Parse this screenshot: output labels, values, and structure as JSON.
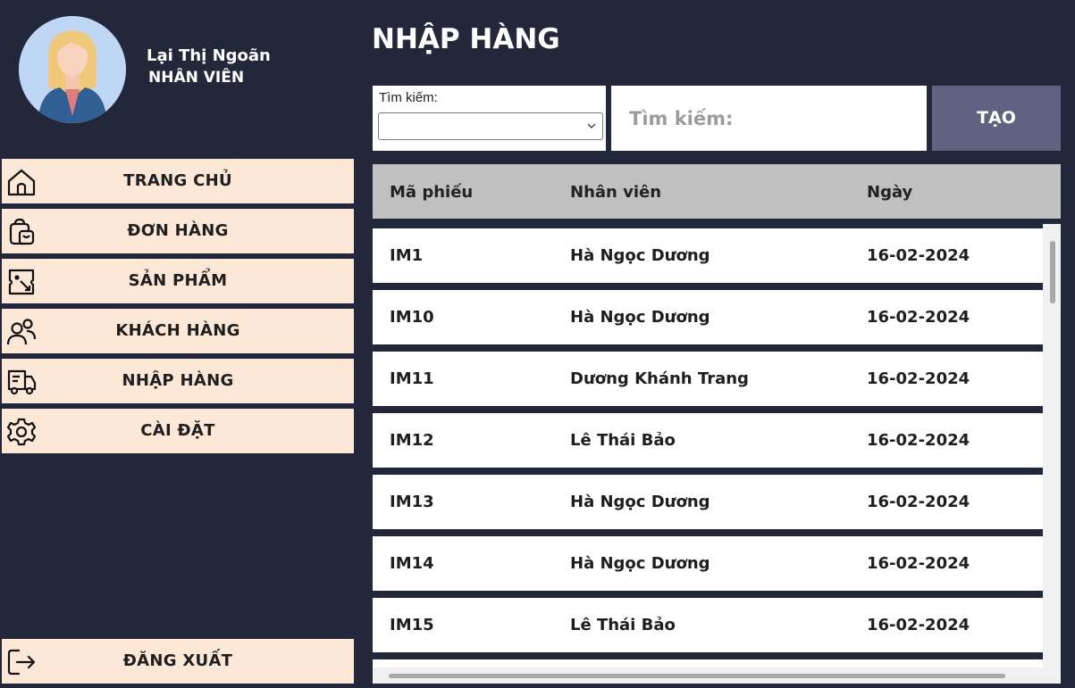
{
  "user": {
    "name": "Lại Thị Ngoãn",
    "role": "NHÂN VIÊN",
    "avatar_icon": "female-user-avatar"
  },
  "sidebar": {
    "items": [
      {
        "label": "TRANG CHỦ",
        "icon": "home-icon"
      },
      {
        "label": "ĐƠN HÀNG",
        "icon": "shopping-bag-icon"
      },
      {
        "label": "SẢN PHẨM",
        "icon": "product-tag-icon"
      },
      {
        "label": "KHÁCH HÀNG",
        "icon": "customers-icon"
      },
      {
        "label": "NHẬP HÀNG",
        "icon": "truck-icon"
      },
      {
        "label": "CÀI ĐẶT",
        "icon": "gear-icon"
      }
    ],
    "logout": {
      "label": "ĐĂNG XUẤT",
      "icon": "logout-icon"
    }
  },
  "main": {
    "title": "NHẬP HÀNG",
    "filter": {
      "label": "Tìm kiếm:",
      "selected": ""
    },
    "search": {
      "placeholder": "Tìm kiếm:",
      "value": ""
    },
    "create_label": "TẠO",
    "table": {
      "columns": [
        "Mã phiếu",
        "Nhân viên",
        "Ngày"
      ],
      "rows": [
        [
          "IM1",
          "Hà Ngọc Dương",
          "16-02-2024"
        ],
        [
          "IM10",
          "Hà Ngọc Dương",
          "16-02-2024"
        ],
        [
          "IM11",
          "Dương Khánh Trang",
          "16-02-2024"
        ],
        [
          "IM12",
          "Lê Thái Bảo",
          "16-02-2024"
        ],
        [
          "IM13",
          "Hà Ngọc Dương",
          "16-02-2024"
        ],
        [
          "IM14",
          "Hà Ngọc Dương",
          "16-02-2024"
        ],
        [
          "IM15",
          "Lê Thái Bảo",
          "16-02-2024"
        ]
      ]
    }
  },
  "colors": {
    "background": "#23273a",
    "nav_item": "#fde8d8",
    "create_button": "#5f6280",
    "table_header": "#c0c0c0",
    "row": "#ffffff"
  }
}
